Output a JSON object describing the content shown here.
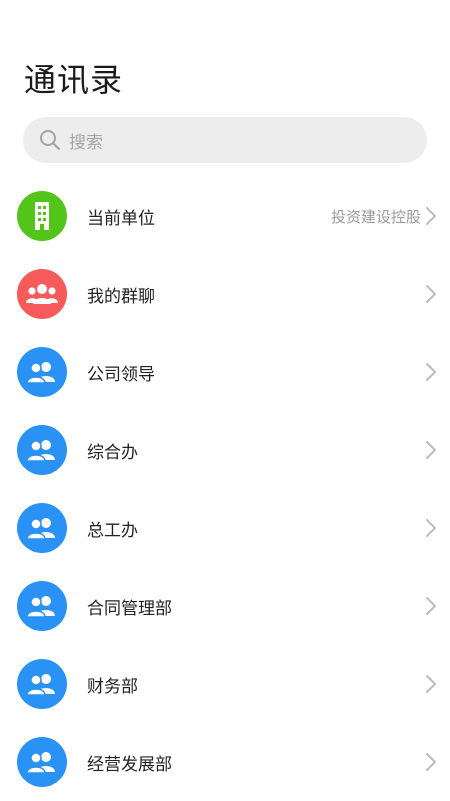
{
  "header": {
    "title": "通讯录"
  },
  "search": {
    "placeholder": "搜索"
  },
  "colors": {
    "green": "#52C41A",
    "red": "#F65A5A",
    "blue": "#2B92F5"
  },
  "items": [
    {
      "label": "当前单位",
      "value": "投资建设控股",
      "icon": "building-icon",
      "color": "green"
    },
    {
      "label": "我的群聊",
      "value": "",
      "icon": "group-chat-icon",
      "color": "red"
    },
    {
      "label": "公司领导",
      "value": "",
      "icon": "people-icon",
      "color": "blue"
    },
    {
      "label": "综合办",
      "value": "",
      "icon": "people-icon",
      "color": "blue"
    },
    {
      "label": "总工办",
      "value": "",
      "icon": "people-icon",
      "color": "blue"
    },
    {
      "label": "合同管理部",
      "value": "",
      "icon": "people-icon",
      "color": "blue"
    },
    {
      "label": "财务部",
      "value": "",
      "icon": "people-icon",
      "color": "blue"
    },
    {
      "label": "经营发展部",
      "value": "",
      "icon": "people-icon",
      "color": "blue"
    }
  ]
}
